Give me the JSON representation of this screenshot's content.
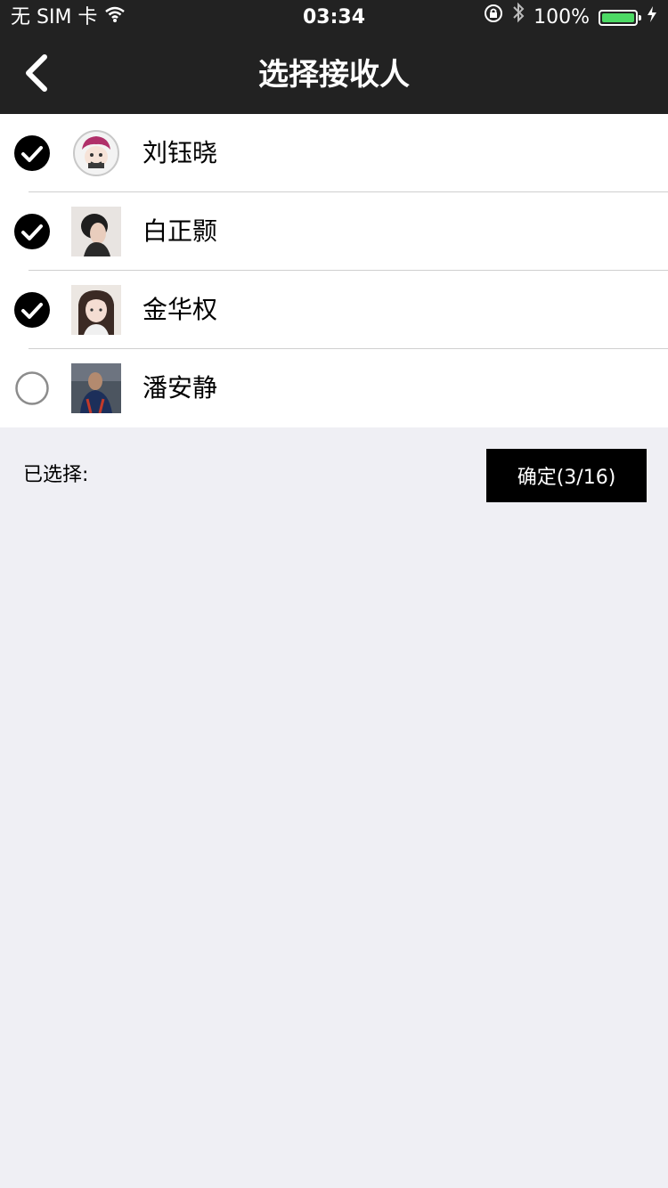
{
  "status_bar": {
    "carrier": "无 SIM 卡",
    "time": "03:34",
    "battery": "100%",
    "battery_level": 1.0,
    "battery_color": "#4cd964"
  },
  "nav": {
    "title": "选择接收人",
    "back_icon": "chevron-left-icon"
  },
  "recipients": [
    {
      "name": "刘钰晓",
      "checked": true,
      "avatar": "avatar-1"
    },
    {
      "name": "白正颢",
      "checked": true,
      "avatar": "avatar-2"
    },
    {
      "name": "金华权",
      "checked": true,
      "avatar": "avatar-3"
    },
    {
      "name": "潘安静",
      "checked": false,
      "avatar": "avatar-4"
    }
  ],
  "footer": {
    "selected_label": "已选择:",
    "confirm_label": "确定(3/16)"
  },
  "colors": {
    "nav_bg": "#222222",
    "page_bg": "#efeff4",
    "confirm_bg": "#000000"
  }
}
